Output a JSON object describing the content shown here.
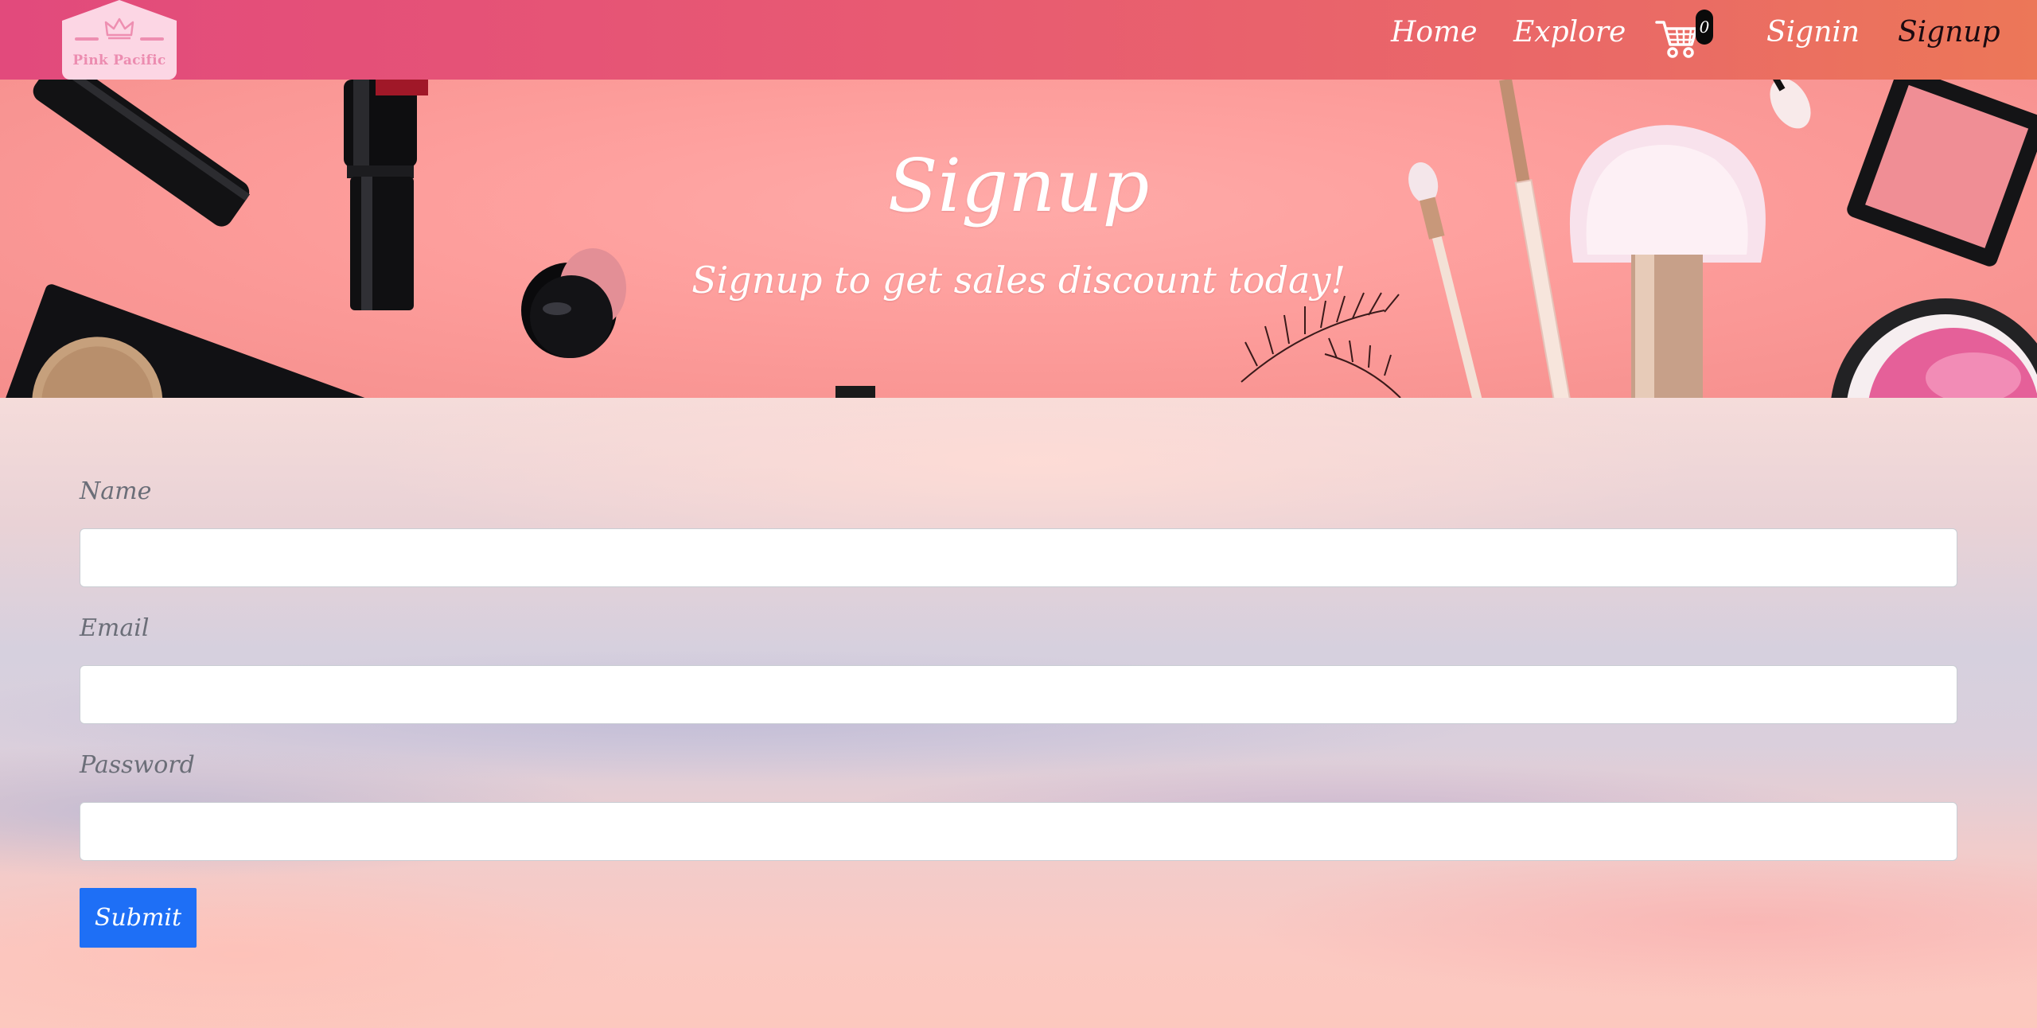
{
  "brand": {
    "logo_name": "Pink Pacific",
    "logo_icon": "crown-icon"
  },
  "nav": {
    "home": "Home",
    "explore": "Explore",
    "cart_icon": "cart-icon",
    "cart_count": "0",
    "signin": "Signin",
    "signup": "Signup"
  },
  "hero": {
    "title": "Signup",
    "subtitle": "Signup to get sales discount today!"
  },
  "form": {
    "name_label": "Name",
    "name_value": "",
    "email_label": "Email",
    "email_value": "",
    "password_label": "Password",
    "password_value": "",
    "submit_label": "Submit"
  },
  "colors": {
    "navbar_start": "#e24a7c",
    "navbar_end": "#ec7758",
    "hero_bg": "#fd9d9b",
    "submit_button": "#1e6ff6",
    "active_nav": "#1b0a10"
  }
}
